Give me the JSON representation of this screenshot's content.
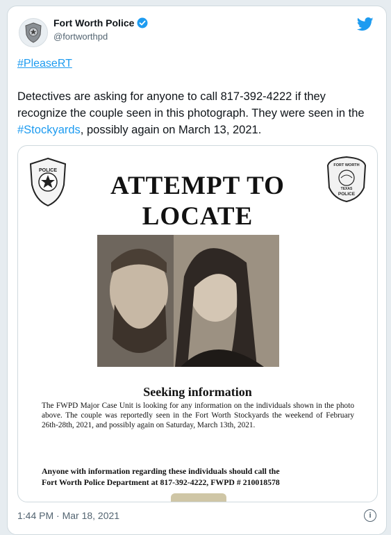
{
  "author": {
    "name": "Fort Worth Police",
    "handle": "@fortworthpd"
  },
  "tweet": {
    "hashtag_line": "#PleaseRT",
    "text_part1": "Detectives are asking for anyone to call 817-392-4222 if they recognize the couple seen in this photograph. They were seen in the ",
    "text_tag": "#Stockyards",
    "text_part2": ", possibly again on March 13, 2021.",
    "timestamp": "1:44 PM · Mar 18, 2021"
  },
  "poster": {
    "title_line1": "ATTEMPT TO",
    "title_line2": "LOCATE",
    "left_badge_text": "POLICE",
    "right_badge_top": "FORT WORTH",
    "right_badge_mid": "TEXAS",
    "right_badge_bottom": "POLICE",
    "seeking_heading": "Seeking information",
    "paragraph": "The FWPD Major Case Unit is looking for any information on the individuals shown in the photo above. The couple was reportedly seen in the Fort Worth Stockyards the weekend of February 26th-28th, 2021, and possibly again on Saturday, March 13th, 2021.",
    "call_line1": "Anyone with information regarding these individuals should call the",
    "call_line2": "Fort Worth Police Department at 817-392-4222, FWPD # 210018578"
  },
  "colors": {
    "link": "#1d9bf0",
    "text": "#0f1419",
    "muted": "#536471"
  }
}
